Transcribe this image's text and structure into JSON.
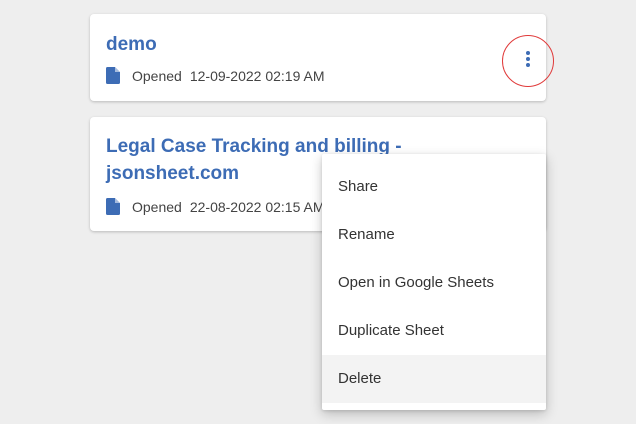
{
  "colors": {
    "title": "#3d6cb5",
    "icon": "#3d6cb5",
    "highlight_ring": "#e03a3a",
    "background": "#eeeeee"
  },
  "sheets": [
    {
      "title": "demo",
      "opened_label": "Opened",
      "opened_at": "12-09-2022 02:19 AM",
      "icon": "file-icon"
    },
    {
      "title": "Legal Case Tracking and billing - jsonsheet.com",
      "opened_label": "Opened",
      "opened_at": "22-08-2022 02:15 AM",
      "icon": "file-icon"
    }
  ],
  "more_button_icon": "more-vert-icon",
  "menu": {
    "items": [
      {
        "label": "Share"
      },
      {
        "label": "Rename"
      },
      {
        "label": "Open in Google Sheets"
      },
      {
        "label": "Duplicate Sheet"
      },
      {
        "label": "Delete"
      }
    ],
    "hovered_item": "Delete"
  }
}
